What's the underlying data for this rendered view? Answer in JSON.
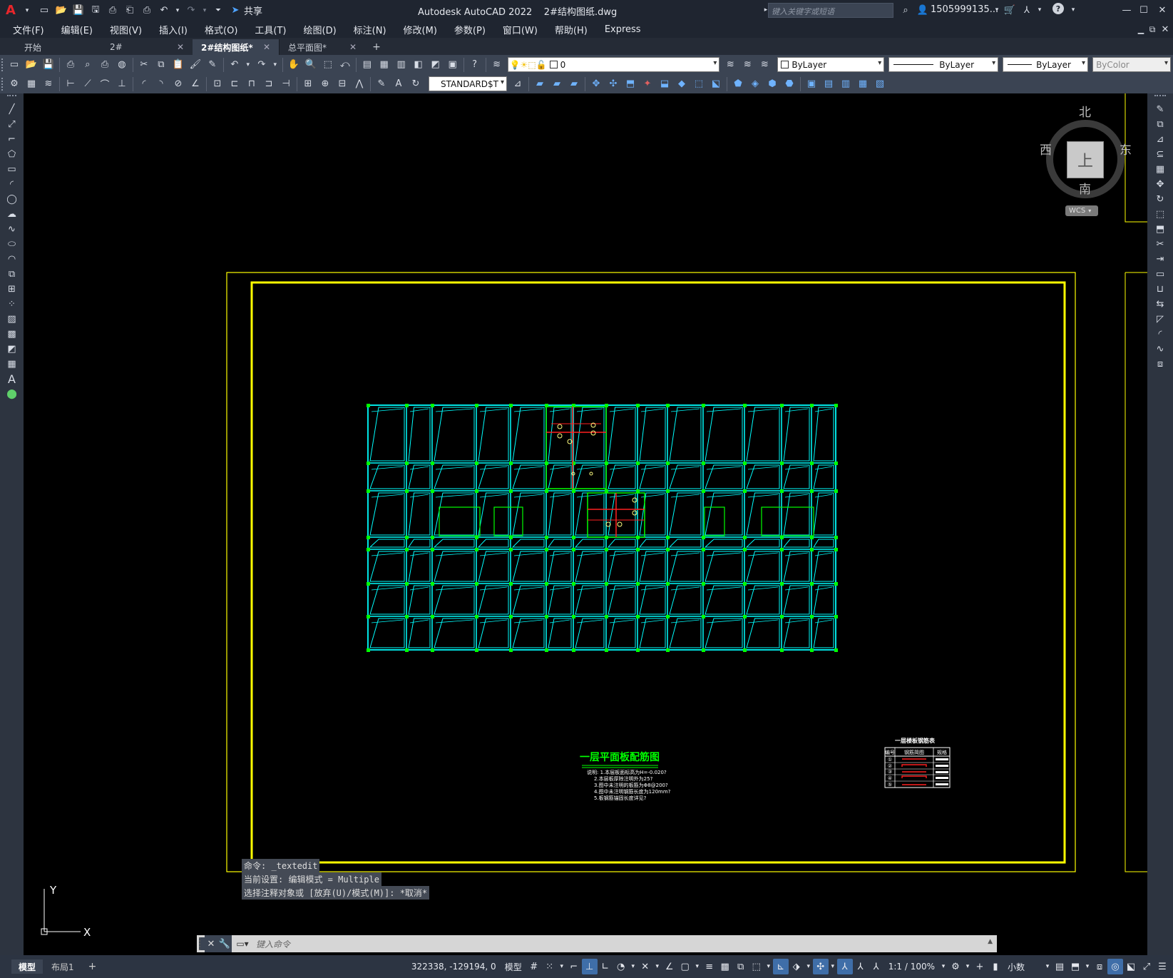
{
  "titlebar": {
    "app_logo": "A",
    "share_label": "共享",
    "title": "Autodesk AutoCAD 2022",
    "filename": "2#结构图纸.dwg",
    "search_placeholder": "键入关键字或短语",
    "user": "1505999135...",
    "help": "?"
  },
  "menubar": {
    "items": [
      "文件(F)",
      "编辑(E)",
      "视图(V)",
      "插入(I)",
      "格式(O)",
      "工具(T)",
      "绘图(D)",
      "标注(N)",
      "修改(M)",
      "参数(P)",
      "窗口(W)",
      "帮助(H)",
      "Express"
    ]
  },
  "tabs": {
    "items": [
      {
        "label": "开始",
        "closable": false
      },
      {
        "label": "2#",
        "closable": true
      },
      {
        "label": "2#结构图纸*",
        "closable": true
      },
      {
        "label": "总平面图*",
        "closable": true
      }
    ],
    "add": "+"
  },
  "toolbar": {
    "layer_value": "0",
    "color_value": "ByLayer",
    "linetype_value": "ByLayer",
    "lineweight_value": "ByLayer",
    "plotstyle_value": "ByColor",
    "textstyle_value": "STANDARD$T"
  },
  "viewcube": {
    "north": "北",
    "south": "南",
    "east": "东",
    "west": "西",
    "top": "上",
    "wcs": "WCS"
  },
  "drawing": {
    "plan_title": "一层平面板配筋图",
    "notes": [
      "说明: 1.本层板面标高为H=-0.020?",
      "2.本层板厚除注明外为25?",
      "3.图中未注明的板筋为Φ8@200?",
      "4.图中未注明钢筋长度为120mm?",
      "5.板钢筋锚固长度详见?"
    ],
    "table_title": "一层楼板钢筋表",
    "table_headers": [
      "编号",
      "钢筋简图",
      "规格"
    ],
    "table_rows": [
      "①",
      "②",
      "③",
      "④",
      "⑤"
    ]
  },
  "ucs": {
    "x_label": "X",
    "y_label": "Y"
  },
  "command": {
    "history": [
      "命令: _textedit",
      "当前设置: 编辑模式 = Multiple",
      "选择注释对象或 [放弃(U)/模式(M)]: *取消*"
    ],
    "placeholder": "键入命令"
  },
  "status": {
    "model_tab": "模型",
    "layout_tab": "布局1",
    "add": "+",
    "coords": "322338, -129194, 0",
    "mode": "模型",
    "scale": "1:1 / 100%",
    "units": "小数"
  },
  "colors": {
    "frame": "#ffff00",
    "wall": "#00ffff",
    "column": "#00ff00",
    "rebar": "#ff2020",
    "title_green": "#00ff00"
  }
}
